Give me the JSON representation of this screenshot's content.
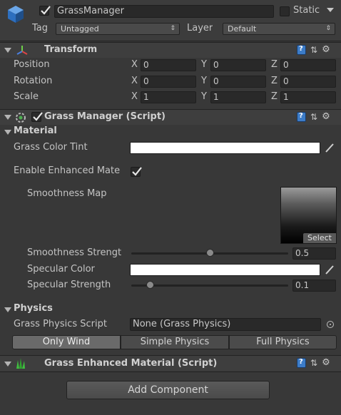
{
  "object": {
    "name": "GrassManager",
    "static_label": "Static",
    "tag_label": "Tag",
    "tag_value": "Untagged",
    "layer_label": "Layer",
    "layer_value": "Default"
  },
  "transform": {
    "title": "Transform",
    "rows": [
      {
        "label": "Position",
        "x": "0",
        "y": "0",
        "z": "0"
      },
      {
        "label": "Rotation",
        "x": "0",
        "y": "0",
        "z": "0"
      },
      {
        "label": "Scale",
        "x": "1",
        "y": "1",
        "z": "1"
      }
    ],
    "axis_x": "X",
    "axis_y": "Y",
    "axis_z": "Z"
  },
  "grass_manager": {
    "title": "Grass Manager (Script)",
    "material_section": "Material",
    "color_tint_label": "Grass Color Tint",
    "enhanced_label": "Enable Enhanced Mate",
    "smoothness_map_label": "Smoothness Map",
    "select_label": "Select",
    "smoothness_strength_label": "Smoothness Strengt",
    "smoothness_strength_value": "0.5",
    "smoothness_strength_level": 0.5,
    "specular_color_label": "Specular Color",
    "specular_strength_label": "Specular Strength",
    "specular_strength_value": "0.1",
    "specular_strength_level": 0.1,
    "physics_section": "Physics",
    "physics_script_label": "Grass Physics Script",
    "physics_script_value": "None (Grass Physics)",
    "modes": [
      "Only Wind",
      "Simple Physics",
      "Full Physics"
    ],
    "active_mode": "Only Wind"
  },
  "enhanced_material": {
    "title": "Grass Enhanced Material (Script)"
  },
  "add_component_label": "Add Component"
}
